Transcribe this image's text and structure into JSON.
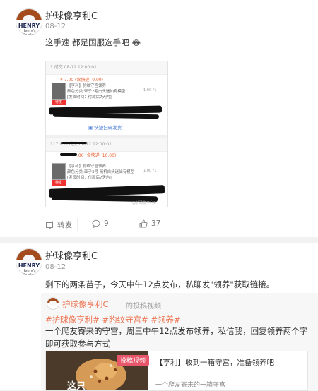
{
  "post1": {
    "username": "护球像亨利C",
    "date": "08-12",
    "avatar_text": "HENRY",
    "avatar_sub": "Henry's Garden",
    "text": "这手速 都是国服选手吧",
    "emoji": "😂",
    "screenshot": {
      "order1": {
        "header": "    1  成交  08-12 12:00:01",
        "amount": "¥ 7.00  (含快递: 0.00)",
        "item_line1": "【亨利】豹纹守宫领养",
        "item_line2": "颜色分类:亚子2毛白头迷仙有模型",
        "item_line3": "[发货时间：付款后7天内]",
        "item_right": "1.00 *1",
        "pill": "待发",
        "ship_link": "快捷扫码发货"
      },
      "order2": {
        "header": "117        933  成交  08-12 12:00:01",
        "amount": ".00  (含快递: 10.00)",
        "item_line1": "【亨利】豹纹守宫领养",
        "item_line2": "颜色分类:亚子3号 随机白头迷仙有模型",
        "item_line3": "[发货时间：付款后7天内]",
        "item_right": "1.00 *1",
        "pill": "待发",
        "watermark": "@护球像亨利C"
      }
    },
    "actions": {
      "repost": "转发",
      "comment_count": "9",
      "like_count": "37"
    }
  },
  "post2": {
    "username": "护球像亨利C",
    "date": "08-12",
    "avatar_text": "HENRY",
    "avatar_sub": "Henry's Garden",
    "text": "剩下的两条苗子，今天中午12点发布，私聊发\"领养\"获取链接。",
    "repost": {
      "author_name": "护球像亨利C",
      "author_suffix": "的投稿视频",
      "tags": "#护球像亨利# #豹纹守宫# #领养#",
      "body": "一个爬友寄来的守宫，周三中午12点发布领养，私信我，回复领养两个字即可获取参与方式",
      "card": {
        "badge": "投稿视频",
        "title": "【亨利】收到一箱守宫，准备领养吧",
        "subtitle": "一个爬友寄来的一箱守宫",
        "overlay": "这只"
      }
    }
  },
  "colors": {
    "accent": "#eb7350",
    "link_blue": "#4a7cd9",
    "background": "#f2f2f2"
  }
}
